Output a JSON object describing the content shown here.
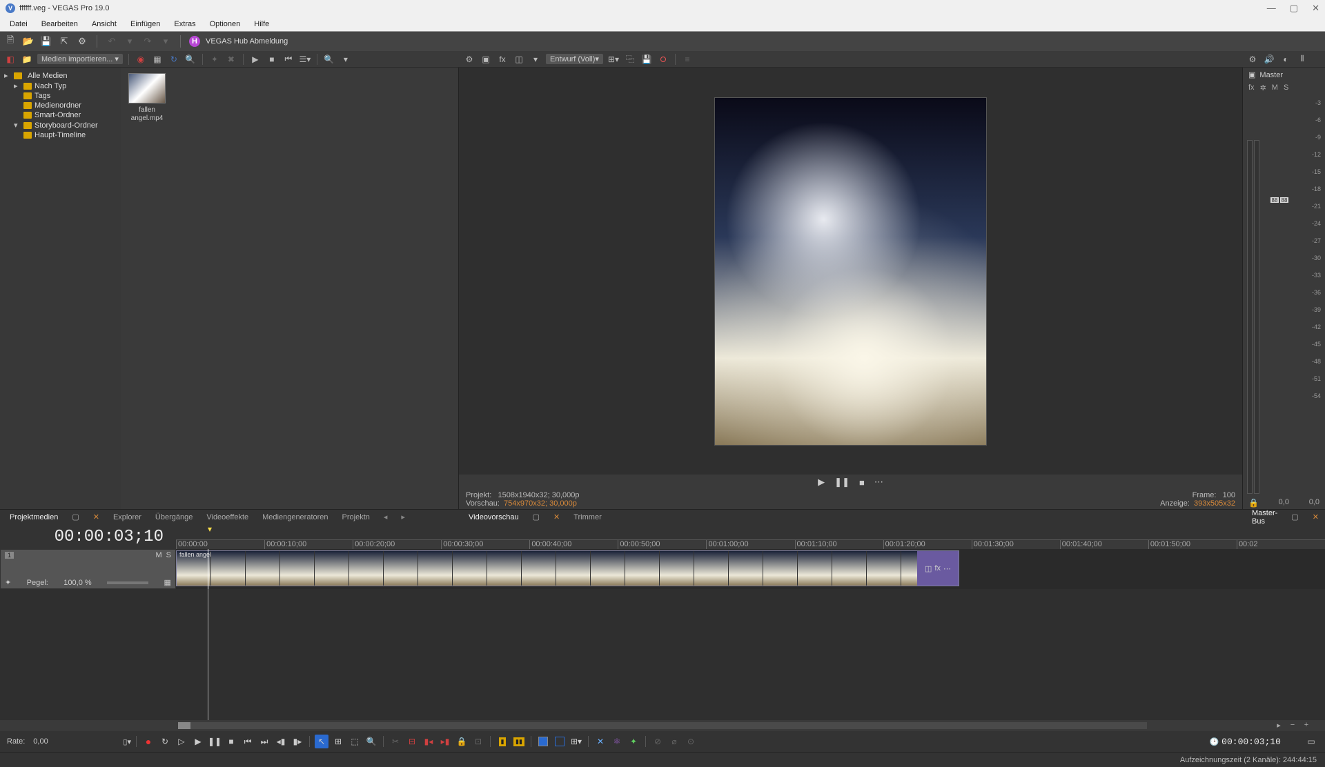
{
  "window": {
    "title": "ffffff.veg - VEGAS Pro 19.0"
  },
  "menu": [
    "Datei",
    "Bearbeiten",
    "Ansicht",
    "Einfügen",
    "Extras",
    "Optionen",
    "Hilfe"
  ],
  "hub": {
    "label": "VEGAS Hub Abmeldung",
    "badge": "H"
  },
  "mediaImport": "Medien importieren...",
  "tree": {
    "root": "Alle Medien",
    "items": [
      "Nach Typ",
      "Tags",
      "Medienordner",
      "Smart-Ordner",
      "Storyboard-Ordner"
    ],
    "sub": "Haupt-Timeline"
  },
  "mediaItem": {
    "name": "fallen angel.mp4"
  },
  "previewToolbar": {
    "quality": "Entwurf (Voll)"
  },
  "previewInfo": {
    "projektLabel": "Projekt:",
    "projektVal": "1508x1940x32; 30,000p",
    "vorschauLabel": "Vorschau:",
    "vorschauVal": "754x970x32; 30,000p",
    "frameLabel": "Frame:",
    "frameVal": "100",
    "anzeigeLabel": "Anzeige:",
    "anzeigeVal": "393x505x32"
  },
  "tabs": {
    "left": [
      "Projektmedien",
      "Explorer",
      "Übergänge",
      "Videoeffekte",
      "Mediengeneratoren",
      "Projektn"
    ],
    "mid": [
      "Videovorschau",
      "Trimmer"
    ],
    "right": "Master-Bus"
  },
  "master": {
    "label": "Master",
    "fx": "fx",
    "m": "M",
    "s": "S",
    "foot1": "0,0",
    "foot2": "0,0",
    "peak": "88"
  },
  "meterTicks": [
    "-3",
    "-6",
    "-9",
    "-12",
    "-15",
    "-18",
    "-21",
    "-24",
    "-27",
    "-30",
    "-33",
    "-36",
    "-39",
    "-42",
    "-45",
    "-48",
    "-51",
    "-54"
  ],
  "timeline": {
    "timecode": "00:00:03;10",
    "ruler": [
      "00:00:00",
      "00:00:10;00",
      "00:00:20;00",
      "00:00:30;00",
      "00:00:40;00",
      "00:00:50;00",
      "00:01:00;00",
      "00:01:10;00",
      "00:01:20;00",
      "00:01:30;00",
      "00:01:40;00",
      "00:01:50;00",
      "00:02"
    ],
    "track": {
      "num": "1",
      "m": "M",
      "s": "S",
      "pegelLabel": "Pegel:",
      "pegelVal": "100,0 %"
    },
    "clip": {
      "name": "fallen angel",
      "fx": "fx"
    }
  },
  "transport": {
    "rateLabel": "Rate:",
    "rateVal": "0,00",
    "timecode": "00:00:03;10"
  },
  "status": "Aufzeichnungszeit (2 Kanäle): 244:44:15"
}
